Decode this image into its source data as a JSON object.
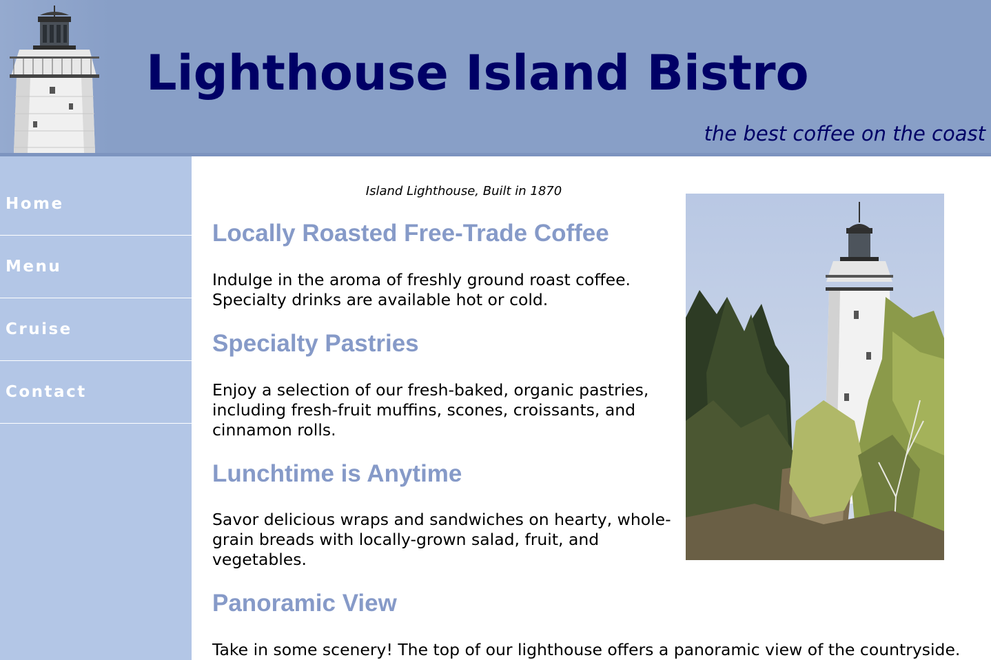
{
  "header": {
    "title": "Lighthouse Island Bistro",
    "tagline": "the best coffee on the coast"
  },
  "nav": {
    "items": [
      {
        "label": "Home"
      },
      {
        "label": "Menu"
      },
      {
        "label": "Cruise"
      },
      {
        "label": "Contact"
      }
    ]
  },
  "content": {
    "photo_caption": "Island Lighthouse, Built in 1870",
    "sections": [
      {
        "heading": "Locally Roasted Free-Trade Coffee",
        "text": "Indulge in the aroma of freshly ground roast coffee. Specialty drinks are available hot or cold."
      },
      {
        "heading": "Specialty Pastries",
        "text": "Enjoy a selection of our fresh-baked, organic pastries, including fresh-fruit muffins, scones, croissants, and cinnamon rolls."
      },
      {
        "heading": "Lunchtime is Anytime",
        "text": "Savor delicious wraps and sandwiches on hearty, whole-grain breads with locally-grown salad, fruit, and vegetables."
      },
      {
        "heading": "Panoramic View",
        "text": "Take in some scenery! The top of our lighthouse offers a panoramic view of the countryside."
      }
    ]
  },
  "colors": {
    "header_bg": "#889fc7",
    "title": "#000066",
    "sidebar_bg": "#b3c6e6",
    "heading": "#869ac8",
    "nav_text": "#ffffff"
  }
}
